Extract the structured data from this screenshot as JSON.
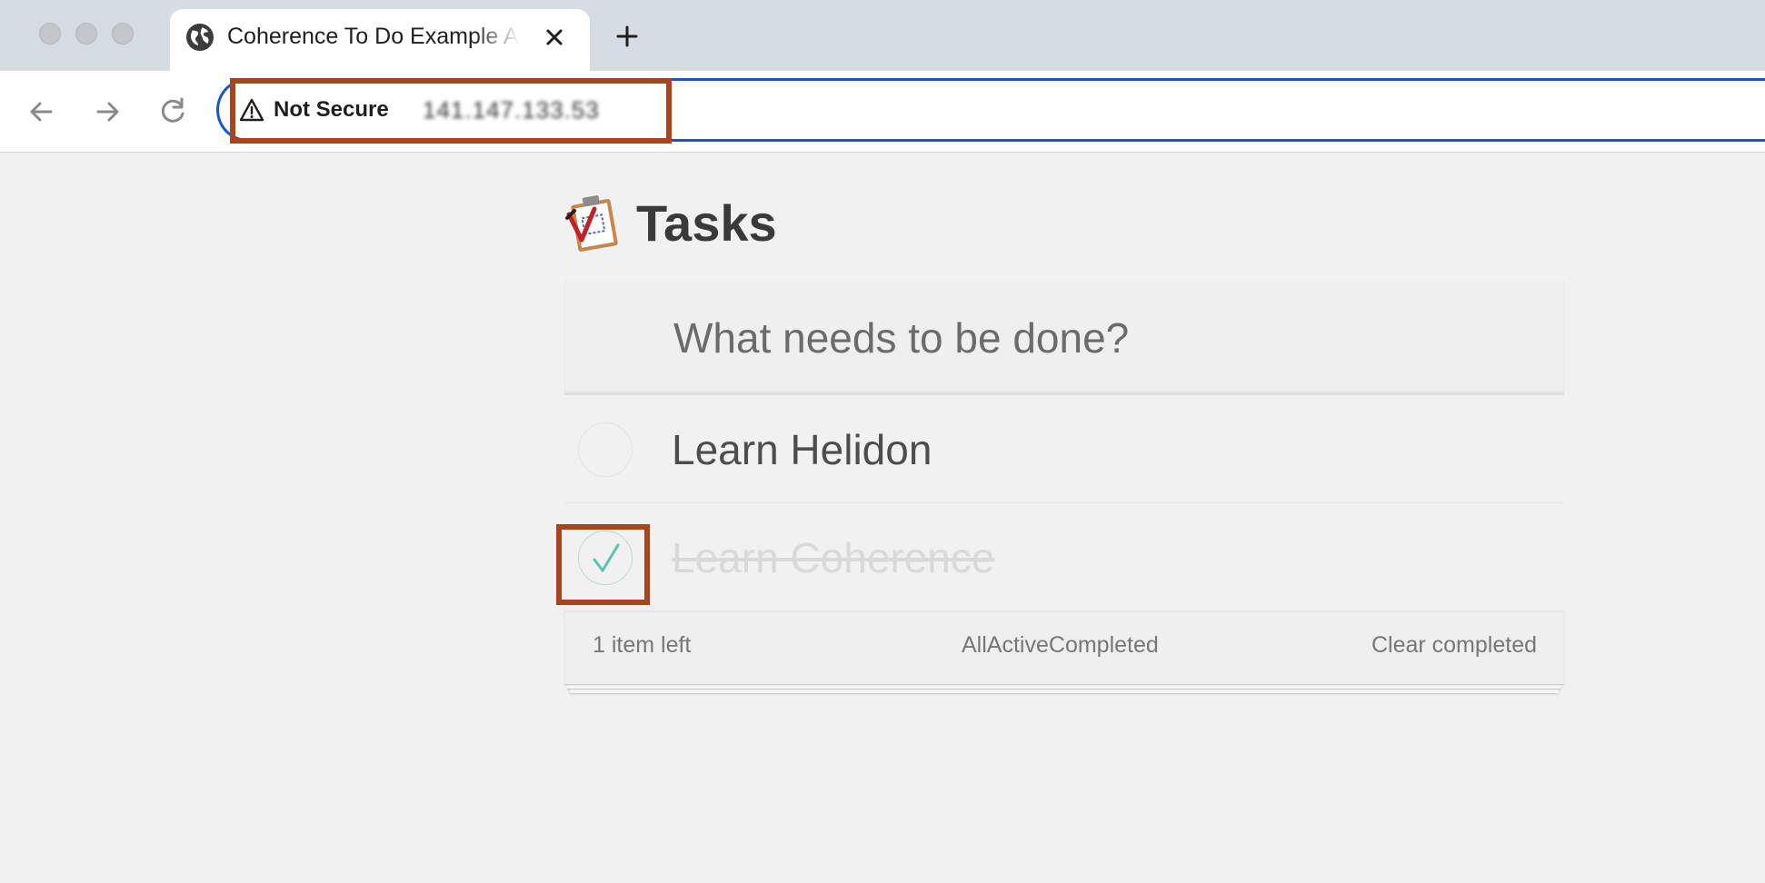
{
  "browser": {
    "tab": {
      "title": "Coherence To Do Example App",
      "icon": "globe-icon"
    },
    "new_tab_icon": "plus-icon",
    "toolbar": {
      "back_icon": "arrow-left-icon",
      "forward_icon": "arrow-right-icon",
      "reload_icon": "reload-icon"
    },
    "omnibox": {
      "security_label": "Not Secure",
      "security_icon": "warning-triangle-icon",
      "url": "141.147.133.53"
    },
    "accent_color": "#1a56c8"
  },
  "app": {
    "title": "Tasks",
    "logo_icon": "clipboard-check-icon",
    "new_todo_placeholder": "What needs to be done?",
    "todos": [
      {
        "label": "Learn Helidon",
        "completed": false
      },
      {
        "label": "Learn Coherence",
        "completed": true
      }
    ],
    "footer": {
      "items_left": "1 item left",
      "filters": [
        "All",
        "Active",
        "Completed"
      ],
      "clear_completed": "Clear completed"
    },
    "check_color": "#5dc2af"
  },
  "annotations": {
    "highlight_color": "#a6461e"
  }
}
